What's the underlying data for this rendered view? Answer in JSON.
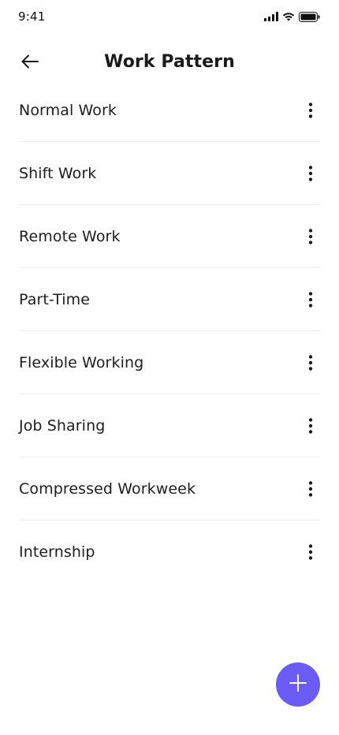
{
  "status_bar": {
    "time": "9:41",
    "icons": [
      "signal-icon",
      "wifi-icon",
      "battery-icon"
    ]
  },
  "header": {
    "back_icon": "back-arrow-icon",
    "title": "Work Pattern"
  },
  "work_patterns": [
    {
      "label": "Normal Work",
      "menu_icon": "more-vertical-icon"
    },
    {
      "label": "Shift Work",
      "menu_icon": "more-vertical-icon"
    },
    {
      "label": "Remote Work",
      "menu_icon": "more-vertical-icon"
    },
    {
      "label": "Part-Time",
      "menu_icon": "more-vertical-icon"
    },
    {
      "label": "Flexible Working",
      "menu_icon": "more-vertical-icon"
    },
    {
      "label": "Job Sharing",
      "menu_icon": "more-vertical-icon"
    },
    {
      "label": "Compressed Workweek",
      "menu_icon": "more-vertical-icon"
    },
    {
      "label": "Internship",
      "menu_icon": "more-vertical-icon"
    }
  ],
  "fab": {
    "icon": "plus-icon"
  },
  "colors": {
    "accent": "#6B5CF6",
    "text": "#1A1A1A",
    "divider": "#ECECEC",
    "background": "#FFFFFF"
  }
}
